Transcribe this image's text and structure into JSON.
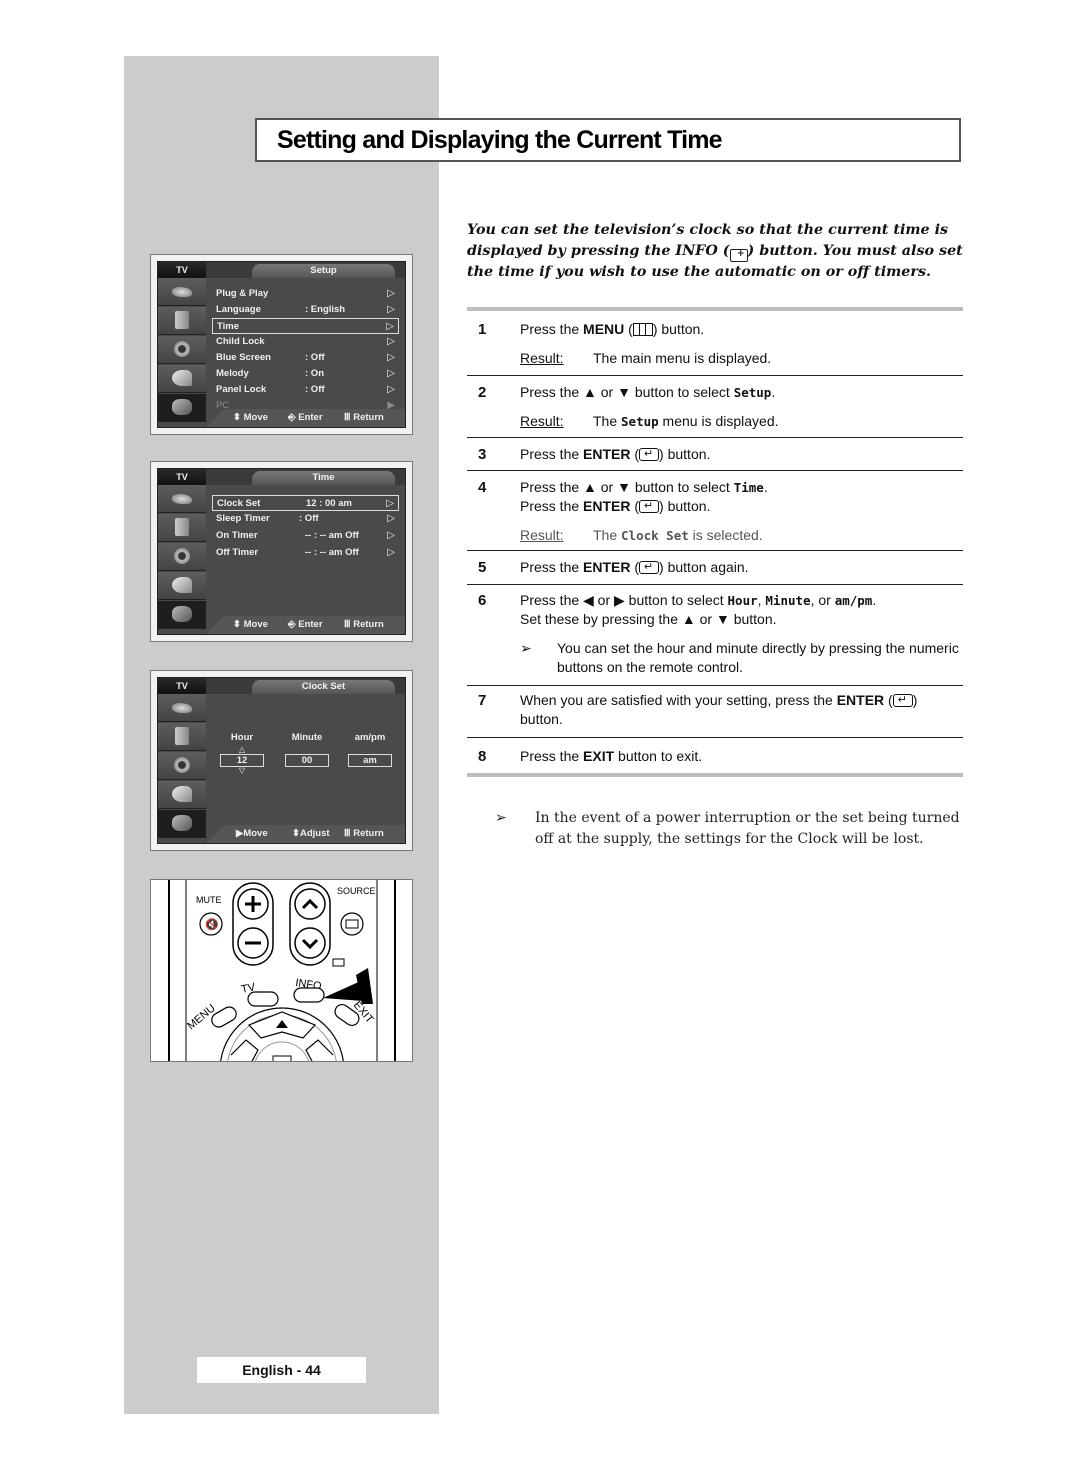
{
  "page": {
    "title": "Setting and Displaying the Current Time",
    "page_label": "English - 44"
  },
  "intro": {
    "part1": "You can set the television’s clock so that the current time is displayed by pressing the INFO (",
    "info_symbol": "+",
    "part2": ") button. You must also set the time if you wish to use the automatic on or off timers."
  },
  "osd_screens": [
    {
      "tv_label": "TV",
      "menu_title": "Setup",
      "rows": [
        {
          "label": "Plug & Play",
          "value": "",
          "arrow": "▷",
          "highlight": false,
          "dim": false
        },
        {
          "label": "Language",
          "value": ": English",
          "arrow": "▷",
          "highlight": false,
          "dim": false
        },
        {
          "label": "Time",
          "value": "",
          "arrow": "▷",
          "highlight": true,
          "dim": false
        },
        {
          "label": "Child Lock",
          "value": "",
          "arrow": "▷",
          "highlight": false,
          "dim": false
        },
        {
          "label": "Blue Screen",
          "value": ": Off",
          "arrow": "▷",
          "highlight": false,
          "dim": false
        },
        {
          "label": "Melody",
          "value": ": On",
          "arrow": "▷",
          "highlight": false,
          "dim": false
        },
        {
          "label": "Panel Lock",
          "value": ": Off",
          "arrow": "▷",
          "highlight": false,
          "dim": false
        },
        {
          "label": "PC",
          "value": "",
          "arrow": "▶",
          "highlight": false,
          "dim": true
        }
      ],
      "footer": {
        "move": "Move",
        "enter": "Enter",
        "return": "Return"
      }
    },
    {
      "tv_label": "TV",
      "menu_title": "Time",
      "rows": [
        {
          "label": "Clock Set",
          "value": "12 : 00 am",
          "arrow": "▷",
          "highlight": true,
          "dim": false
        },
        {
          "label": "Sleep Timer",
          "value": ": Off",
          "arrow": "▷",
          "highlight": false,
          "dim": false
        },
        {
          "label": "On Timer",
          "value": "-- : -- am Off",
          "arrow": "▷",
          "highlight": false,
          "dim": false
        },
        {
          "label": "Off Timer",
          "value": "-- : -- am Off",
          "arrow": "▷",
          "highlight": false,
          "dim": false
        }
      ],
      "footer": {
        "move": "Move",
        "enter": "Enter",
        "return": "Return"
      }
    },
    {
      "tv_label": "TV",
      "menu_title": "Clock Set",
      "fields": [
        {
          "label": "Hour",
          "value": "12"
        },
        {
          "label": "Minute",
          "value": "00"
        },
        {
          "label": "am/pm",
          "value": "am"
        }
      ],
      "footer": {
        "move": "Move",
        "adjust": "Adjust",
        "return": "Return"
      }
    }
  ],
  "remote": {
    "mute": "MUTE",
    "source": "SOURCE",
    "tv": "TV",
    "info": "INFO",
    "menu": "MENU",
    "exit": "EXIT"
  },
  "steps": [
    {
      "num": "1",
      "lines": [
        "Press the ",
        "MENU",
        " (",
        "menu-symbol",
        ") button."
      ],
      "result_label": "Result:",
      "result": "The main menu is displayed."
    },
    {
      "num": "2",
      "pre": "Press the ▲ or ▼ button to select ",
      "code": "Setup",
      "post": ".",
      "result_label": "Result:",
      "result_pre": "The ",
      "result_code": "Setup",
      "result_post": " menu is displayed."
    },
    {
      "num": "3",
      "pre": "Press the ",
      "bold": "ENTER",
      "post": ") button."
    },
    {
      "num": "4",
      "pre": "Press the ▲ or ▼ button to select ",
      "code": "Time",
      "post": ".",
      "line2_pre": "Press the ",
      "line2_bold": "ENTER",
      "line2_post": ") button.",
      "result_label": "Result:",
      "result_pre": "The ",
      "result_code": "Clock Set",
      "result_post": " is selected."
    },
    {
      "num": "5",
      "pre": "Press the ",
      "bold": "ENTER",
      "post": ") button again."
    },
    {
      "num": "6",
      "pre": "Press the ◀ or ▶ button to select ",
      "code1": "Hour",
      "sep1": ", ",
      "code2": "Minute",
      "sep2": ", or ",
      "code3": "am/pm",
      "post": ".",
      "line2": "Set these by pressing the ▲ or ▼ button.",
      "note": "You can set the hour and minute directly by pressing the numeric buttons on the remote control."
    },
    {
      "num": "7",
      "pre": "When you are satisfied with your setting, press the ",
      "bold": "ENTER",
      "post": ")",
      "line2": "button."
    },
    {
      "num": "8",
      "pre": "Press the ",
      "bold": "EXIT",
      "post": " button to exit."
    }
  ],
  "step1": {
    "pre": "Press the ",
    "bold": "MENU",
    "open": " (",
    "post": ") button."
  },
  "open_paren": " (",
  "note_arrow": "➢",
  "footnote": "In the event of a power interruption or the set being turned off at the supply, the settings for the Clock will be lost."
}
